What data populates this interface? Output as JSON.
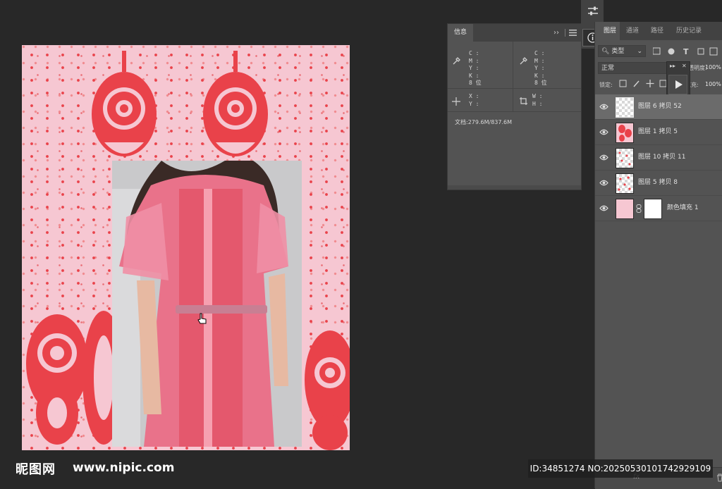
{
  "info_panel": {
    "tab_label": "信息",
    "menu_chevron": "››",
    "cmyk_left": [
      "C :",
      "M :",
      "Y :",
      "K :"
    ],
    "bit_left": "8 位",
    "cmyk_right": [
      "C :",
      "M :",
      "Y :",
      "K :"
    ],
    "bit_right": "8 位",
    "xy": [
      "X :",
      "Y :"
    ],
    "wh": [
      "W :",
      "H :"
    ],
    "doc_size": "文档:279.6M/837.6M"
  },
  "layers_panel": {
    "tabs": [
      "图层",
      "通道",
      "路径",
      "历史记录"
    ],
    "filter_kind": "类型",
    "blend_mode": "正常",
    "opacity_label": "不透明度:",
    "opacity_value": "100%",
    "lock_label": "锁定:",
    "fill_label": "填充:",
    "fill_value": "100%",
    "layers": [
      {
        "name": "图层 6 拷贝 52",
        "selected": true
      },
      {
        "name": "图层 1 拷贝 5",
        "selected": false
      },
      {
        "name": "图层 10 拷贝 11",
        "selected": false
      },
      {
        "name": "图层 5 拷贝 8",
        "selected": false
      },
      {
        "name": "颜色填充 1",
        "selected": false
      }
    ]
  },
  "watermark": {
    "logo": "昵图网",
    "url": "www.nipic.com",
    "id_text": "ID:34851274 NO:20250530101742929109"
  },
  "colors": {
    "background": "#282828",
    "panel": "#535353",
    "pink": "#f6c7d2",
    "paisley_red": "#e9424a"
  }
}
